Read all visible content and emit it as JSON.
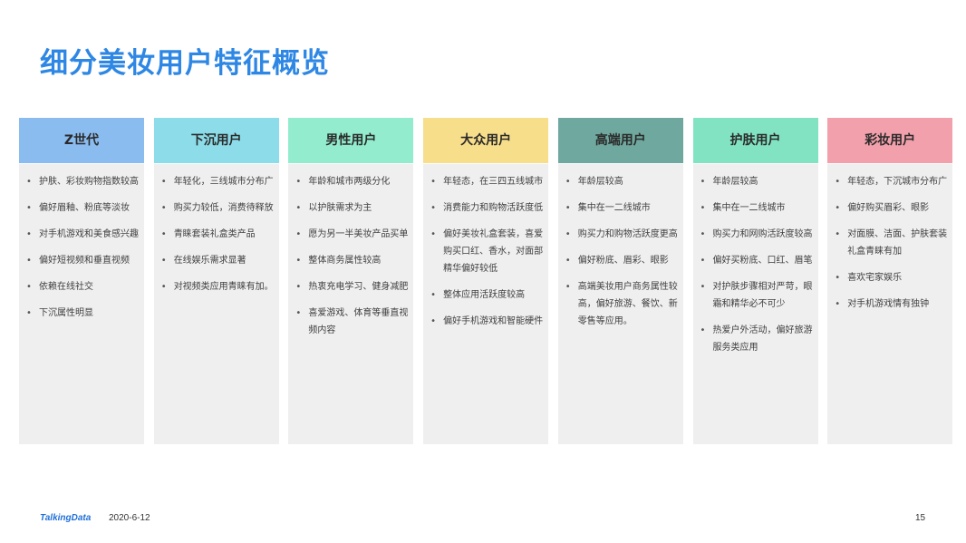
{
  "title": "细分美妆用户特征概览",
  "columns": [
    {
      "header": "Z世代",
      "color": "#8bbcf0",
      "items": [
        "护肤、彩妆购物指数较高",
        "偏好眉釉、粉底等淡妆",
        "对手机游戏和美食感兴趣",
        "偏好短视频和垂直视频",
        "依赖在线社交",
        "下沉属性明显"
      ]
    },
    {
      "header": "下沉用户",
      "color": "#8cdde9",
      "items": [
        "年轻化，三线城市分布广",
        "购买力较低，消费待释放",
        "青睐套装礼盒类产品",
        "在线娱乐需求显著",
        "对视频类应用青睐有加。"
      ]
    },
    {
      "header": "男性用户",
      "color": "#92eccd",
      "items": [
        "年龄和城市两级分化",
        "以护肤需求为主",
        "愿为另一半美妆产品买单",
        "整体商务属性较高",
        "热衷充电学习、健身减肥",
        "喜爱游戏、体育等垂直视频内容"
      ]
    },
    {
      "header": "大众用户",
      "color": "#f7de8a",
      "items": [
        "年轻态，在三四五线城市",
        "消费能力和购物活跃度低",
        "偏好美妆礼盒套装，喜爱购买口红、香水，对面部精华偏好较低",
        "整体应用活跃度较高",
        "偏好手机游戏和智能硬件"
      ]
    },
    {
      "header": "高端用户",
      "color": "#6fa89e",
      "items": [
        "年龄层较高",
        "集中在一二线城市",
        "购买力和购物活跃度更高",
        "偏好粉底、眉彩、眼影",
        "高端美妆用户商务属性较高，偏好旅游、餐饮、新零售等应用。"
      ]
    },
    {
      "header": "护肤用户",
      "color": "#82e3c2",
      "items": [
        "年龄层较高",
        "集中在一二线城市",
        "购买力和网购活跃度较高",
        "偏好买粉底、口红、眉笔",
        "对护肤步骤相对严苛，眼霜和精华必不可少",
        "热爱户外活动，偏好旅游服务类应用"
      ]
    },
    {
      "header": "彩妆用户",
      "color": "#f2a0ab",
      "items": [
        "年轻态，下沉城市分布广",
        "偏好购买眉彩、眼影",
        "对面膜、洁面、护肤套装礼盒青睐有加",
        "喜欢宅家娱乐",
        "对手机游戏情有独钟"
      ]
    }
  ],
  "footer": {
    "logo": "TalkingData",
    "date": "2020-6-12",
    "page": "15"
  }
}
